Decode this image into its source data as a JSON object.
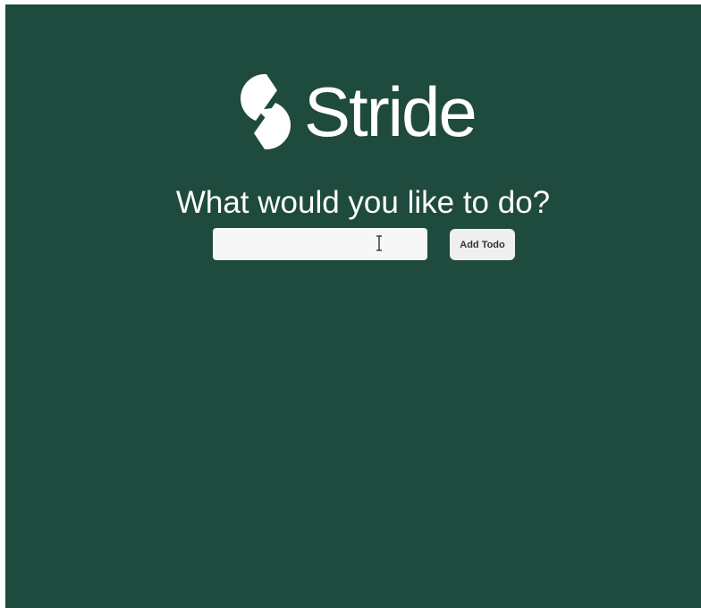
{
  "app": {
    "brand_name": "Stride",
    "logo_icon": "stride-logo-mark-icon"
  },
  "prompt": {
    "heading": "What would you like to do?"
  },
  "todo_form": {
    "input_value": "",
    "input_placeholder": "",
    "add_button_label": "Add Todo",
    "cursor_icon": "i-beam-cursor-icon"
  },
  "colors": {
    "background": "#1f4a3e",
    "foreground": "#ffffff",
    "input_background": "#f7f7f7",
    "button_background": "#efefef",
    "button_text": "#333333"
  }
}
